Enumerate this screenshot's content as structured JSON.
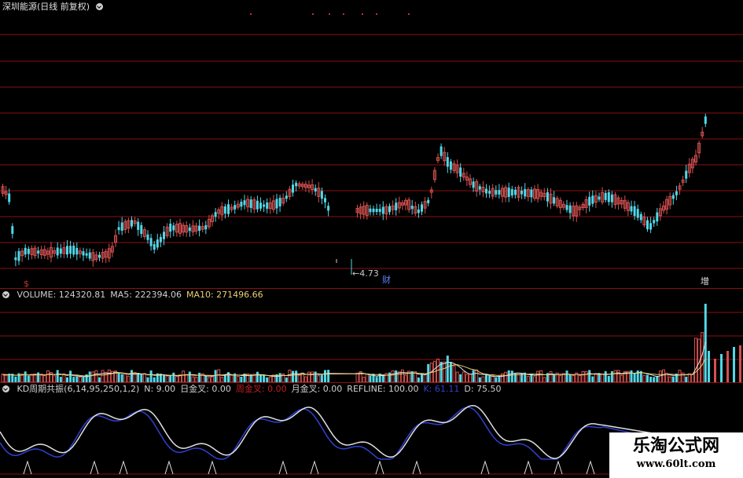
{
  "header": {
    "title": "深圳能源(日线 前复权)"
  },
  "main_panel": {
    "low_marker": "←4.73",
    "marker_cai": "财",
    "marker_zeng": "增",
    "marker_dollar": "$"
  },
  "volume_panel": {
    "items": [
      {
        "label": "VOLUME: 124320.81",
        "color": "#d0d0d0"
      },
      {
        "label": "MA5: 222394.06",
        "color": "#d0d0d0"
      },
      {
        "label": "MA10: 271496.66",
        "color": "#e8d070"
      }
    ]
  },
  "kd_panel": {
    "items": [
      {
        "label": "KD周期共振(6,14,95,250,1,2)",
        "color": "#d0d0d0"
      },
      {
        "label": "N: 9.00",
        "color": "#d0d0d0"
      },
      {
        "label": "日金叉: 0.00",
        "color": "#d0d0d0"
      },
      {
        "label": "周金叉: 0.00",
        "color": "#c02020"
      },
      {
        "label": "月金叉: 0.00",
        "color": "#d0d0d0"
      },
      {
        "label": "REFLINE: 100.00",
        "color": "#d0d0d0"
      },
      {
        "label": "K: 61.11",
        "color": "#3040d0"
      },
      {
        "label": "D: 75.50",
        "color": "#d0d0d0"
      }
    ]
  },
  "watermark": {
    "title": "乐淘公式网",
    "url": "www.60lt.com"
  },
  "colors": {
    "up": "#d45050",
    "down": "#50d8e8",
    "gridline": "#8a1010",
    "k_line": "#3040d0",
    "d_line": "#e0e0e0",
    "ma10": "#e8d070"
  }
}
